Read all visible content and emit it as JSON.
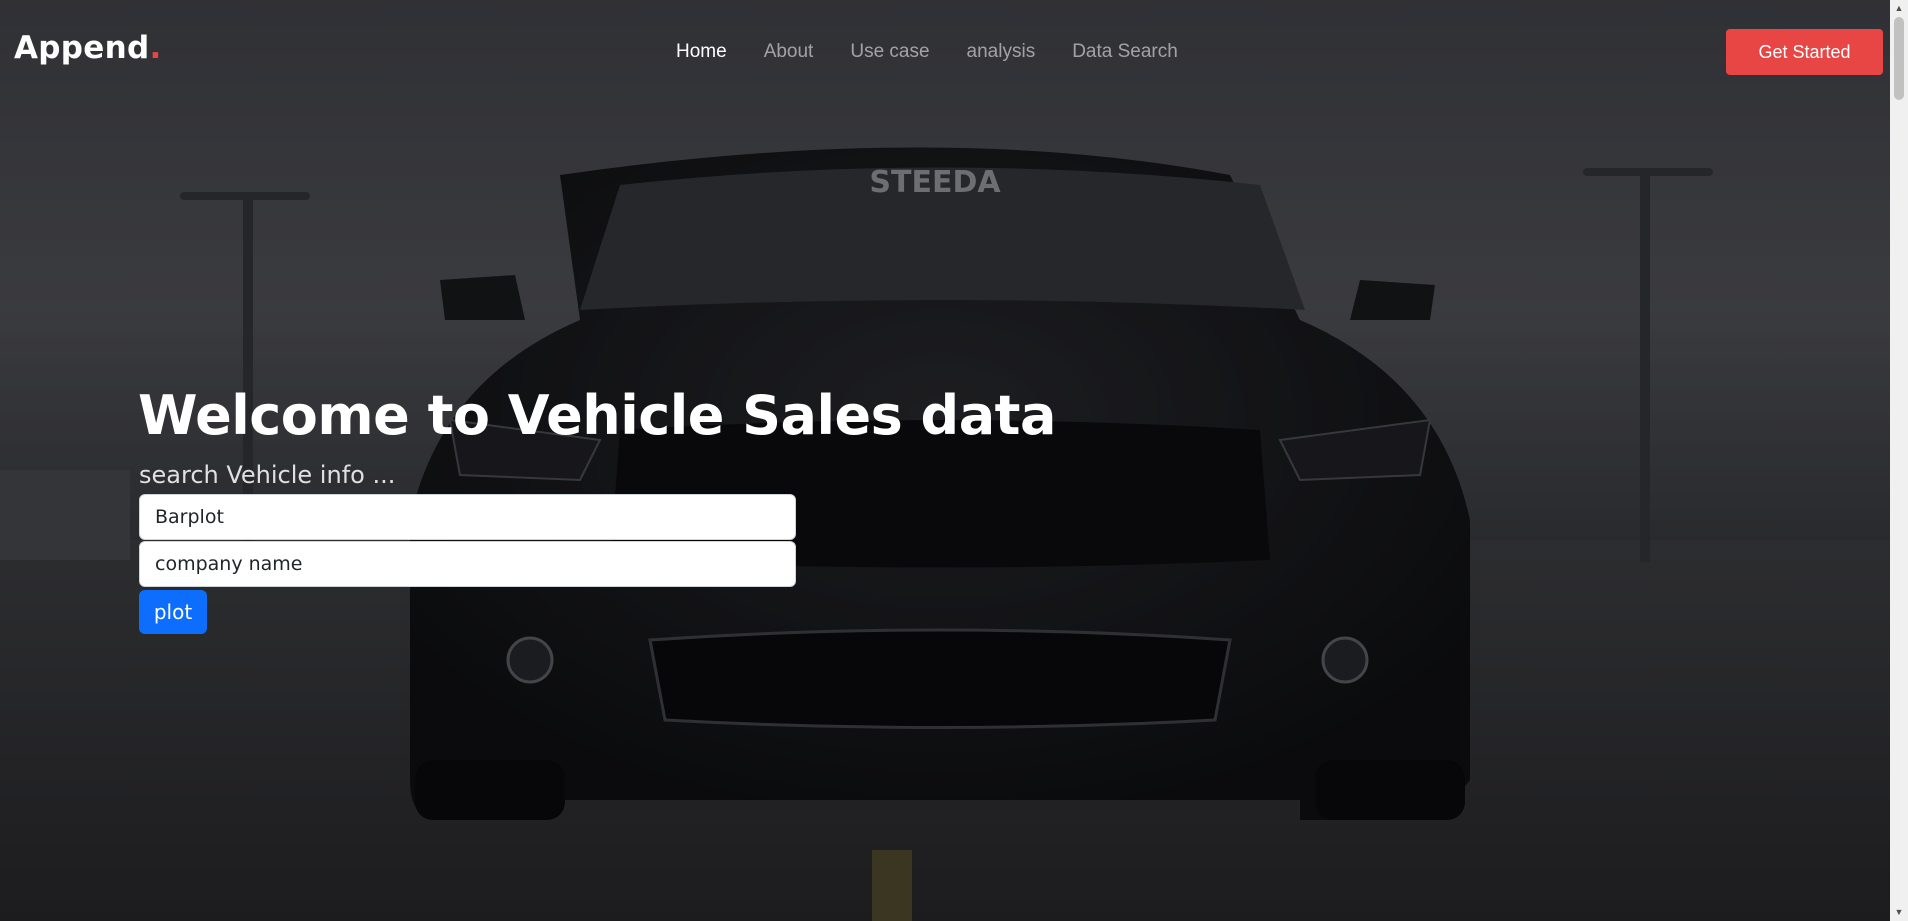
{
  "header": {
    "logo_text": "Append",
    "logo_dot": ".",
    "nav": [
      {
        "label": "Home",
        "active": true
      },
      {
        "label": "About",
        "active": false
      },
      {
        "label": "Use case",
        "active": false
      },
      {
        "label": "analysis",
        "active": false
      },
      {
        "label": "Data Search",
        "active": false
      }
    ],
    "cta_label": "Get Started"
  },
  "hero": {
    "title": "Welcome to Vehicle Sales data",
    "subtitle": "search Vehicle info ...",
    "plot_type_value": "Barplot",
    "company_placeholder": "company name",
    "plot_button_label": "plot",
    "windshield_text": "STEEDA"
  },
  "colors": {
    "accent": "#e84545",
    "primary_button": "#0d6efd",
    "overlay": "#2f3036"
  },
  "icons": {
    "scroll_up": "scroll-up-arrow-icon",
    "scroll_down": "scroll-down-arrow-icon"
  }
}
